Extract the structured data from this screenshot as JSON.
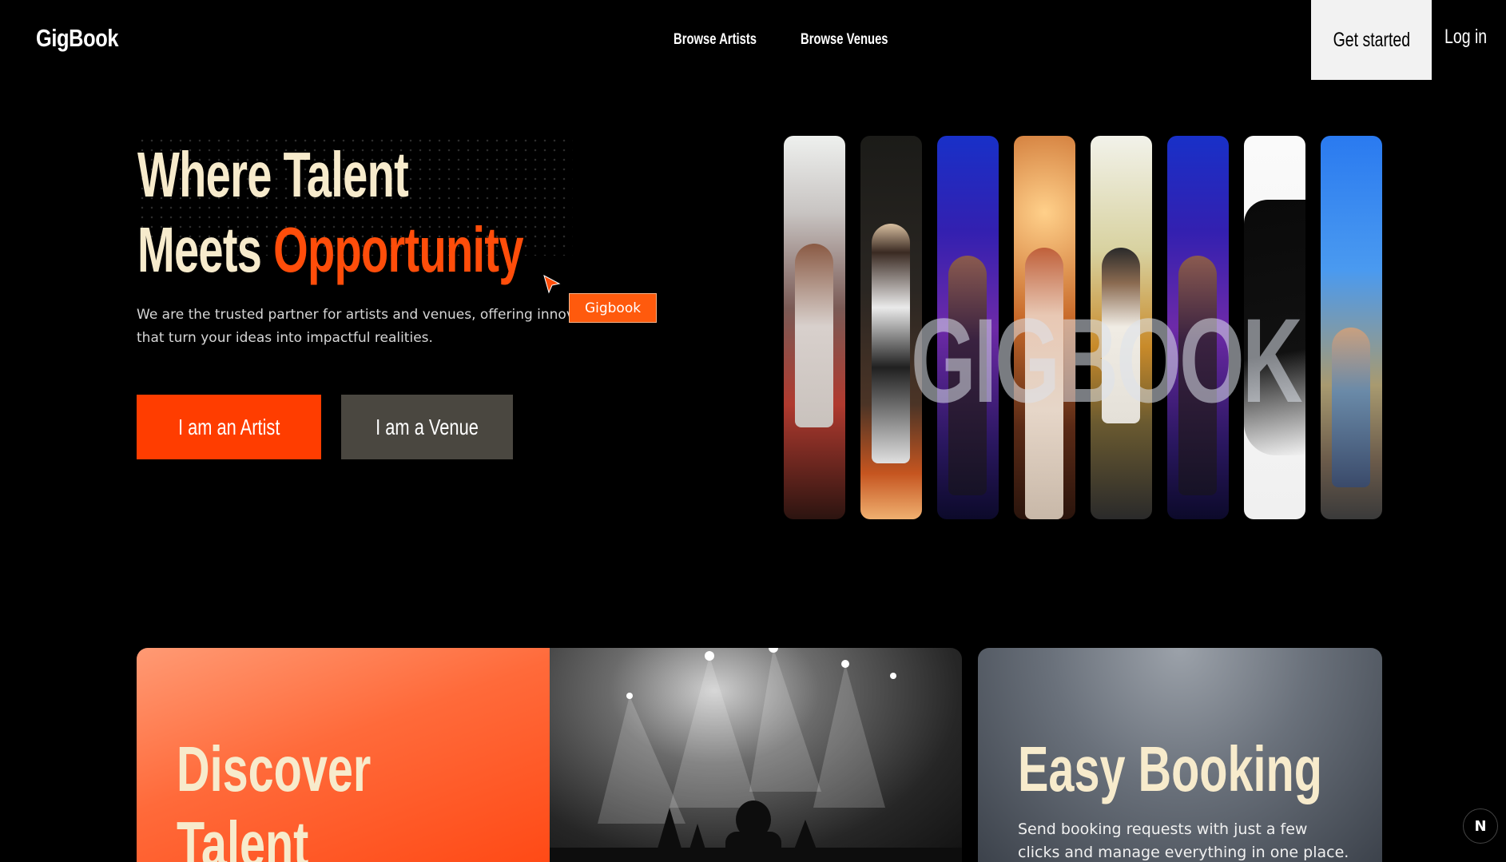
{
  "header": {
    "logo": "GigBook",
    "nav": [
      {
        "label": "Browse Artists"
      },
      {
        "label": "Browse Venues"
      }
    ],
    "get_started": "Get started",
    "login": "Log in"
  },
  "hero": {
    "title_line1": "Where Talent",
    "title_line2_prefix": "Meets ",
    "title_line2_accent": "Opportunity",
    "description_line1": "We are the trusted partner for artists and venues, offering innovativ",
    "description_line2": "that turn your ideas into impactful realities.",
    "badge": "Gigbook",
    "btn_artist": "I am an Artist",
    "btn_venue": "I am a Venue",
    "strips_overlay_text": "GIGBOOK"
  },
  "features": {
    "discover": {
      "title_line1": "Discover",
      "title_line2": "Talent"
    },
    "booking": {
      "title": "Easy Booking",
      "description": "Send booking requests with just a few clicks and manage everything in one place."
    }
  },
  "floating_badge": "N",
  "colors": {
    "accent": "#ff4d0a",
    "cream": "#f7ebcc",
    "venue_button": "#4a4740"
  }
}
